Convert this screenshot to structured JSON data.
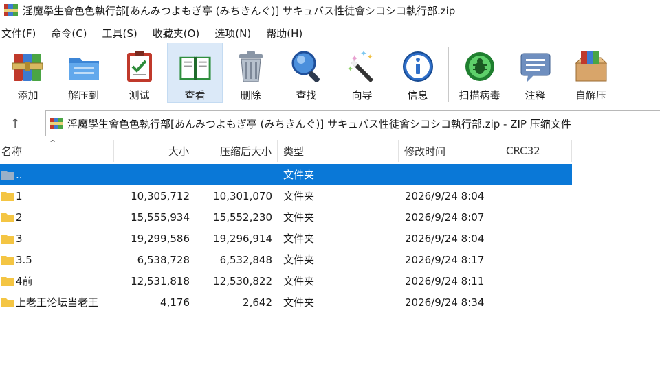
{
  "window": {
    "title": "淫魔學生會色色執行部[あんみつよもぎ亭 (みちきんぐ)] サキュバス性徒會シコシコ執行部.zip"
  },
  "menu": [
    "文件(F)",
    "命令(C)",
    "工具(S)",
    "收藏夹(O)",
    "选项(N)",
    "帮助(H)"
  ],
  "toolbar": {
    "add": "添加",
    "extract": "解压到",
    "test": "测试",
    "view": "查看",
    "delete": "删除",
    "find": "查找",
    "wizard": "向导",
    "info": "信息",
    "scan": "扫描病毒",
    "comment": "注释",
    "sfx": "自解压"
  },
  "address": {
    "up_glyph": "↑",
    "path": "淫魔學生會色色執行部[あんみつよもぎ亭 (みちきんぐ)] サキュバス性徒會シコシコ執行部.zip - ZIP 压缩文件"
  },
  "columns": {
    "name": "名称",
    "size": "大小",
    "packed": "压缩后大小",
    "type": "类型",
    "modified": "修改时间",
    "crc": "CRC32",
    "sort_glyph": "^"
  },
  "rows": [
    {
      "name": "..",
      "size": "",
      "packed": "",
      "type": "文件夹",
      "modified": "",
      "crc": ""
    },
    {
      "name": "1",
      "size": "10,305,712",
      "packed": "10,301,070",
      "type": "文件夹",
      "modified": "2026/9/24 8:04",
      "crc": ""
    },
    {
      "name": "2",
      "size": "15,555,934",
      "packed": "15,552,230",
      "type": "文件夹",
      "modified": "2026/9/24 8:07",
      "crc": ""
    },
    {
      "name": "3",
      "size": "19,299,586",
      "packed": "19,296,914",
      "type": "文件夹",
      "modified": "2026/9/24 8:04",
      "crc": ""
    },
    {
      "name": "3.5",
      "size": "6,538,728",
      "packed": "6,532,848",
      "type": "文件夹",
      "modified": "2026/9/24 8:17",
      "crc": ""
    },
    {
      "name": "4前",
      "size": "12,531,818",
      "packed": "12,530,822",
      "type": "文件夹",
      "modified": "2026/9/24 8:11",
      "crc": ""
    },
    {
      "name": "上老王论坛当老王",
      "size": "4,176",
      "packed": "2,642",
      "type": "文件夹",
      "modified": "2026/9/24 8:34",
      "crc": ""
    }
  ],
  "colors": {
    "selection": "#0a78d7",
    "folder": "#f4c543",
    "active_tool": "#dbe9f8"
  }
}
